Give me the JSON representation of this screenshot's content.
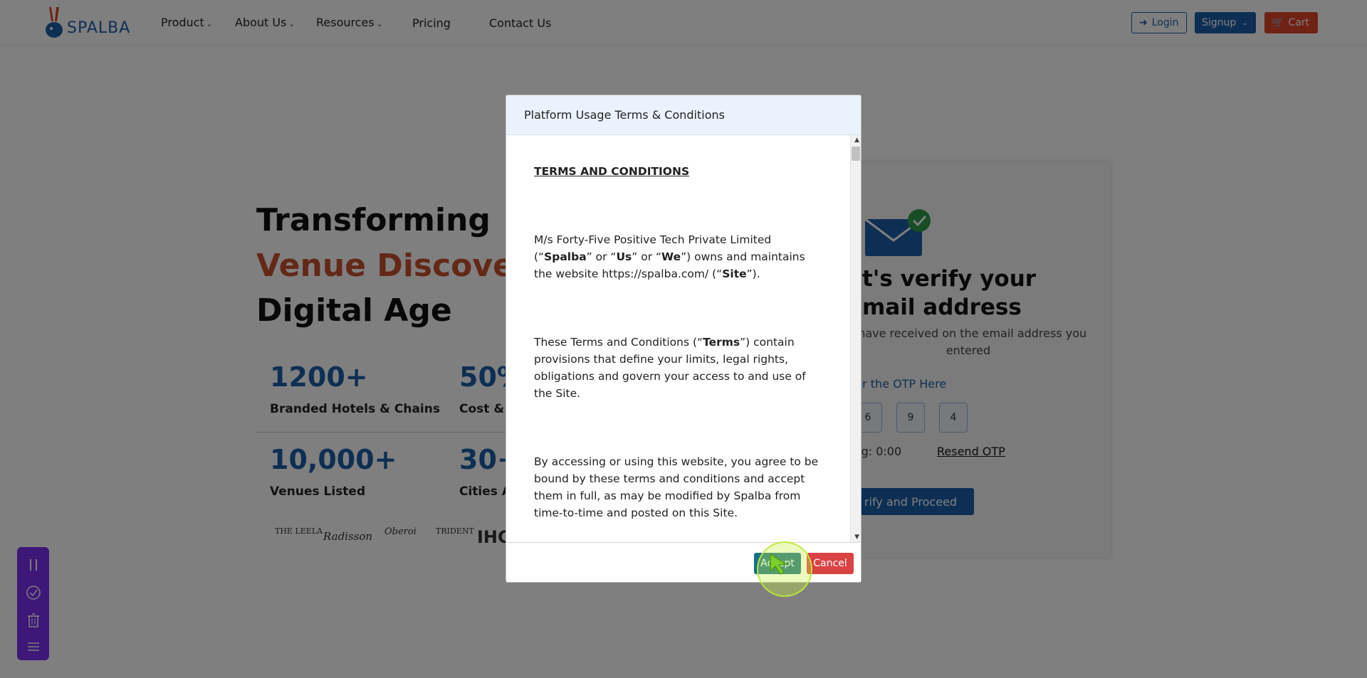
{
  "nav": {
    "logo_text": "SPALBA",
    "items": [
      {
        "label": "Product",
        "has_dropdown": true
      },
      {
        "label": "About Us",
        "has_dropdown": true
      },
      {
        "label": "Resources",
        "has_dropdown": true
      },
      {
        "label": "Pricing",
        "has_dropdown": false
      },
      {
        "label": "Contact Us",
        "has_dropdown": false
      }
    ],
    "login_label": "Login",
    "signup_label": "Signup",
    "cart_label": "Cart"
  },
  "hero": {
    "line1": "Transforming",
    "line2": "Venue Discovery",
    "line3": "Digital Age",
    "stats": [
      {
        "value": "1200+",
        "label": "Branded Hotels & Chains"
      },
      {
        "value": "50%",
        "label": "Cost & T"
      },
      {
        "value": "10,000+",
        "label": "Venues Listed"
      },
      {
        "value": "30+",
        "label": "Cities A"
      }
    ],
    "brands": [
      "THE LEELA",
      "Radisson",
      "Oberoi",
      "TRIDENT",
      "IHG"
    ]
  },
  "verify": {
    "title": "et's verify your email address",
    "subtitle": "t have received on the email address you entered",
    "otp_label": "ter the OTP Here",
    "otp_digits": [
      "6",
      "9",
      "4"
    ],
    "timer_text": "ing: 0:00",
    "resend_label": "Resend OTP",
    "button_label": "rify and Proceed"
  },
  "modal": {
    "title": "Platform Usage Terms & Conditions",
    "terms_heading": "TERMS AND CONDITIONS",
    "para1": {
      "t1": "M/s Forty-Five Positive Tech Private Limited (“",
      "b1": "Spalba",
      "t2": "” or “",
      "b2": "Us",
      "t3": "” or “",
      "b3": "We",
      "t4": "”) owns and maintains the website https://spalba.com/ (“",
      "b4": "Site",
      "t5": "”)."
    },
    "para2": {
      "t1": "These Terms and Conditions (“",
      "b1": "Terms",
      "t2": "”) contain provisions that define your limits, legal rights, obligations and govern your access to and use of the Site."
    },
    "para3": "By accessing or using this website, you agree to be bound by these terms and conditions and accept them in full, as may be modified by Spalba from time-to-time and posted on this Site.",
    "accept_label": "Accept",
    "cancel_label": "Cancel"
  },
  "colors": {
    "brand_blue": "#1d5fa8",
    "accent_orange": "#c9502e",
    "toolbar_purple": "#7d2ff0",
    "accept_teal": "#1a6e86",
    "cancel_red": "#d94343"
  }
}
